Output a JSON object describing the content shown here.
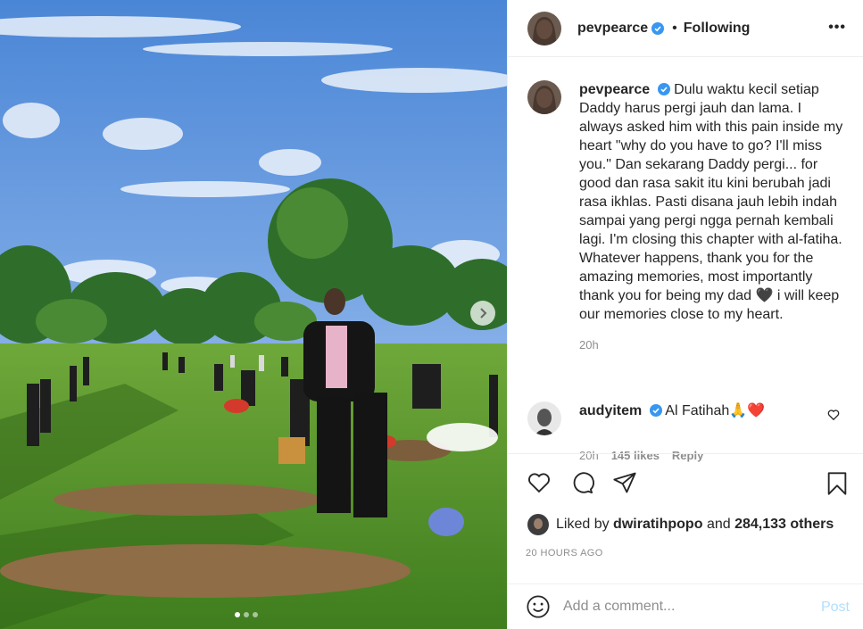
{
  "post": {
    "username": "pevpearce",
    "follow_separator": "•",
    "follow_status": "Following",
    "more_label": "•••"
  },
  "caption": {
    "username": "pevpearce",
    "text": "Dulu waktu kecil setiap Daddy harus pergi jauh dan lama. I always asked him with this pain inside my heart \"why do you have to go? I'll miss you.\" Dan sekarang Daddy pergi... for good dan rasa sakit itu kini berubah jadi rasa ikhlas. Pasti disana jauh lebih indah sampai yang pergi ngga pernah kembali lagi. I'm closing this chapter with al-fatiha. Whatever happens, thank you for the amazing memories, most importantly thank you for being my dad 🖤 i will keep our memories close to my heart.",
    "time": "20h"
  },
  "comment": {
    "username": "audyitem",
    "text": "Al Fatihah🙏❤️",
    "time": "20h",
    "likes": "145 likes",
    "reply": "Reply"
  },
  "likes": {
    "prefix": "Liked by",
    "user": "dwiratihpopo",
    "and": "and",
    "others": "284,133 others"
  },
  "timestamp": "20 HOURS AGO",
  "add_comment": {
    "placeholder": "Add a comment...",
    "post_label": "Post"
  },
  "carousel": {
    "slides": 3,
    "active": 1
  },
  "colors": {
    "verified": "#3897f0",
    "link_muted": "#b2dffc",
    "meta": "#8e8e8e"
  },
  "icons": [
    "more-icon",
    "verified-icon",
    "heart-icon",
    "comment-icon",
    "share-icon",
    "bookmark-icon",
    "emoji-icon",
    "chevron-right-icon"
  ]
}
